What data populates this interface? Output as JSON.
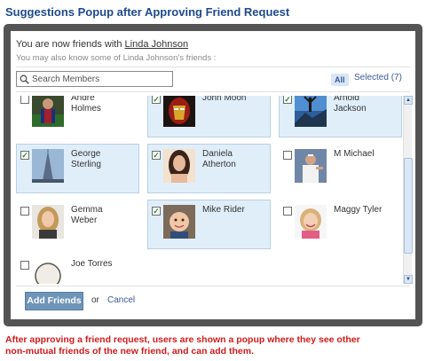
{
  "page": {
    "heading": "Suggestions Popup after Approving Friend Request",
    "caption_line1": "After approving a friend request, users are shown a popup where they see other",
    "caption_line2": "non-mutual friends of the new friend, and can add them."
  },
  "popup": {
    "friend_prefix": "You are now friends with",
    "friend_name": "Linda Johnson",
    "subtext": "You may also know some of Linda Johnson's friends :",
    "search_placeholder": "Search Members",
    "filter_all": "All",
    "filter_selected": "Selected (7)",
    "add_button": "Add Friends",
    "or": "or",
    "cancel": "Cancel"
  },
  "members": [
    {
      "line1": "Andre",
      "line2": "Holmes",
      "checked": false,
      "photo": "photo-soccer-player"
    },
    {
      "line1": "John Moon",
      "line2": "",
      "checked": true,
      "photo": "photo-iron-man"
    },
    {
      "line1": "Arnold",
      "line2": "Jackson",
      "checked": true,
      "photo": "photo-mountain-summit"
    },
    {
      "line1": "George",
      "line2": "Sterling",
      "checked": true,
      "photo": "photo-skyscraper"
    },
    {
      "line1": "Daniela",
      "line2": "Atherton",
      "checked": true,
      "photo": "photo-woman-dark-hair"
    },
    {
      "line1": "M Michael",
      "line2": "",
      "checked": false,
      "photo": "photo-tennis-player"
    },
    {
      "line1": "Gemma",
      "line2": "Weber",
      "checked": false,
      "photo": "photo-blonde-woman"
    },
    {
      "line1": "Mike Rider",
      "line2": "",
      "checked": true,
      "photo": "photo-toddler"
    },
    {
      "line1": "Maggy Tyler",
      "line2": "",
      "checked": false,
      "photo": "photo-girl-smiling"
    },
    {
      "line1": "Joe Torres",
      "line2": "",
      "checked": false,
      "photo": "photo-round-portrait"
    }
  ]
}
